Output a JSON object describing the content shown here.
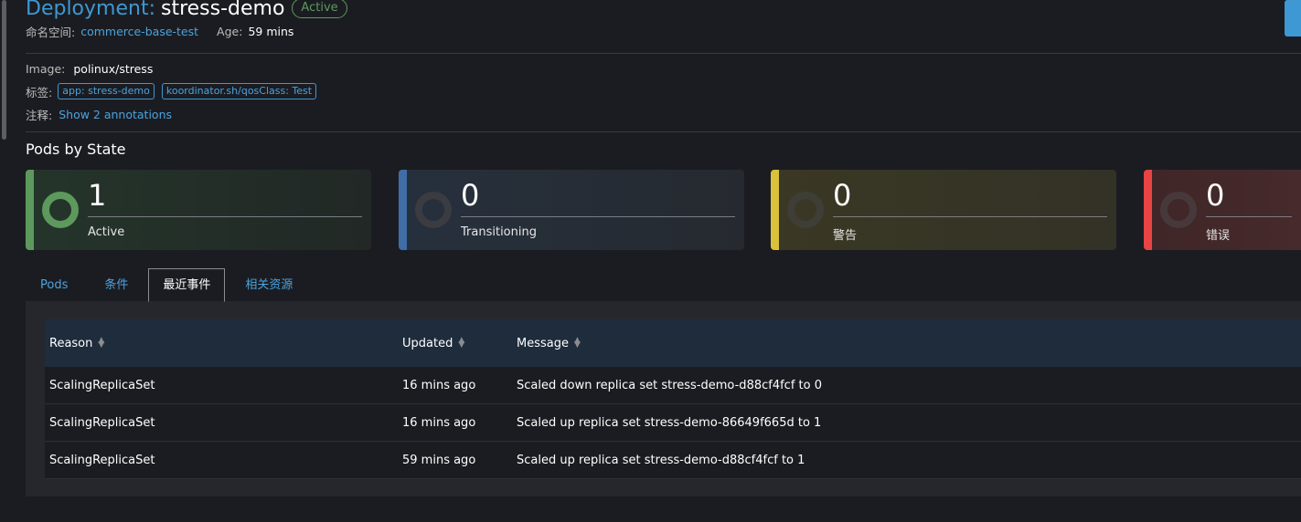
{
  "header": {
    "kind": "Deployment:",
    "name": "stress-demo",
    "status": "Active"
  },
  "meta": {
    "namespace_label": "命名空间:",
    "namespace_value": "commerce-base-test",
    "age_label": "Age:",
    "age_value": "59 mins"
  },
  "details": {
    "image_label": "Image:",
    "image_value": "polinux/stress",
    "labels_label": "标签:",
    "labels": [
      "app: stress-demo",
      "koordinator.sh/qosClass: Test"
    ],
    "annotations_label": "注释:",
    "annotations_link": "Show 2 annotations"
  },
  "pods_by_state": {
    "title": "Pods by State",
    "cards": [
      {
        "count": "1",
        "label": "Active",
        "color": "#5d995d"
      },
      {
        "count": "0",
        "label": "Transitioning",
        "color": "#3e6ea5"
      },
      {
        "count": "0",
        "label": "警告",
        "color": "#d9c13c"
      },
      {
        "count": "0",
        "label": "错误",
        "color": "#e84444"
      }
    ]
  },
  "tabs": [
    "Pods",
    "条件",
    "最近事件",
    "相关资源"
  ],
  "active_tab": "最近事件",
  "events_table": {
    "columns": [
      "Reason",
      "Updated",
      "Message"
    ],
    "rows": [
      {
        "reason": "ScalingReplicaSet",
        "updated": "16 mins ago",
        "message": "Scaled down replica set stress-demo-d88cf4fcf to 0"
      },
      {
        "reason": "ScalingReplicaSet",
        "updated": "16 mins ago",
        "message": "Scaled up replica set stress-demo-86649f665d to 1"
      },
      {
        "reason": "ScalingReplicaSet",
        "updated": "59 mins ago",
        "message": "Scaled up replica set stress-demo-d88cf4fcf to 1"
      }
    ]
  }
}
